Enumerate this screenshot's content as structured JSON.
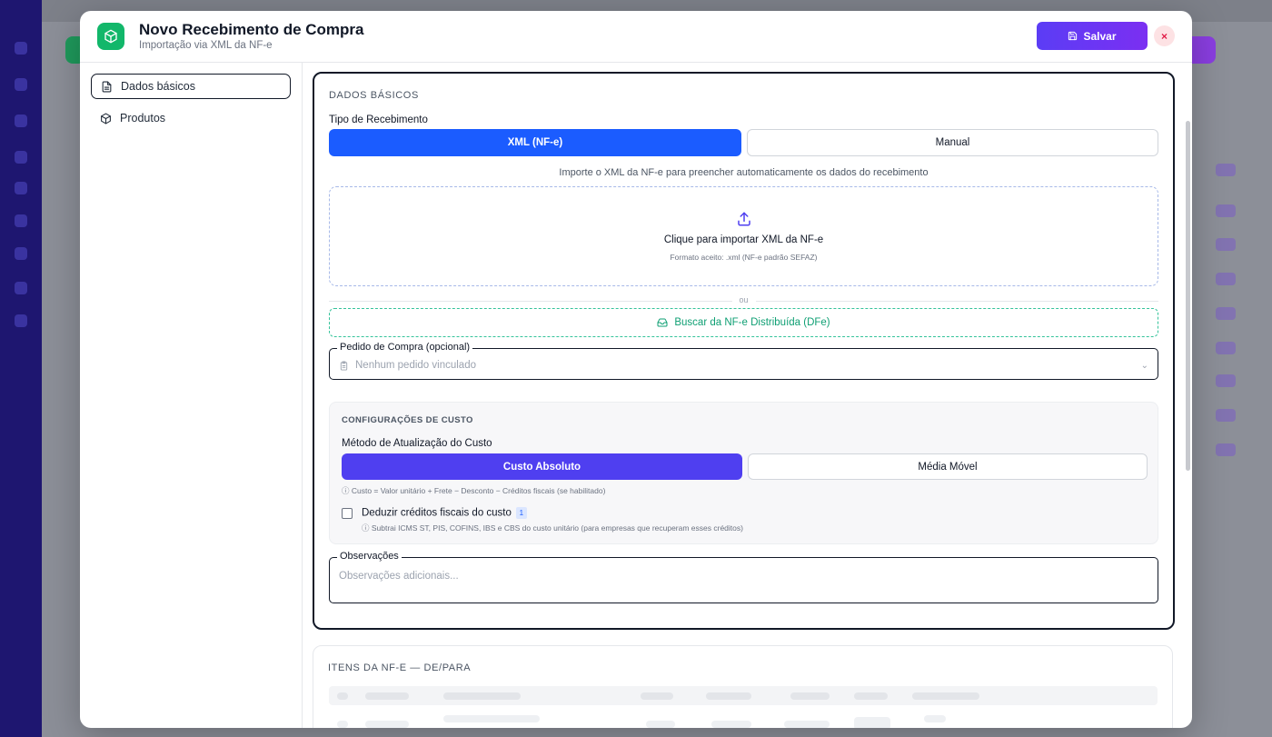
{
  "modal": {
    "title": "Novo Recebimento de Compra",
    "subtitle": "Importação via XML da NF-e",
    "save_label": "Salvar",
    "close_label": "×"
  },
  "nav": {
    "items": [
      {
        "label": "Dados básicos",
        "icon": "document-icon",
        "active": true
      },
      {
        "label": "Produtos",
        "icon": "package-icon",
        "active": false
      }
    ]
  },
  "dados_basicos": {
    "section_title": "DADOS BÁSICOS",
    "tipo_label": "Tipo de Recebimento",
    "tipo_options": [
      "XML (NF-e)",
      "Manual"
    ],
    "tipo_selected": "XML (NF-e)",
    "hint": "Importe o XML da NF-e para preencher automaticamente os dados do recebimento",
    "dropzone_title": "Clique para importar XML da NF-e",
    "dropzone_sub": "Formato aceito: .xml (NF-e padrão SEFAZ)",
    "divider": "ou",
    "dfe_button": "Buscar da NF-e Distribuída (DFe)",
    "pedido_legend": "Pedido de Compra (opcional)",
    "pedido_value": "Nenhum pedido vinculado",
    "custo": {
      "title": "CONFIGURAÇÕES DE CUSTO",
      "metodo_label": "Método de Atualização do Custo",
      "options": [
        "Custo Absoluto",
        "Média Móvel"
      ],
      "selected": "Custo Absoluto",
      "note": "ⓘ Custo = Valor unitário + Frete − Desconto − Créditos fiscais (se habilitado)",
      "deduzir_label": "Deduzir créditos fiscais do custo",
      "deduzir_badge": "1",
      "deduzir_checked": false,
      "deduzir_sub": "ⓘ Subtrai ICMS ST, PIS, COFINS, IBS e CBS do custo unitário (para empresas que recuperam esses créditos)"
    },
    "obs_legend": "Observações",
    "obs_placeholder": "Observações adicionais..."
  },
  "itens": {
    "section_title": "ITENS DA NF-E — DE/PARA"
  },
  "colors": {
    "accent_blue": "#1b5cff",
    "accent_purple": "#4f3ff0",
    "save_gradient": "#5b3df5",
    "success_green": "#12b76a",
    "dfe_green": "#0e9f73"
  }
}
